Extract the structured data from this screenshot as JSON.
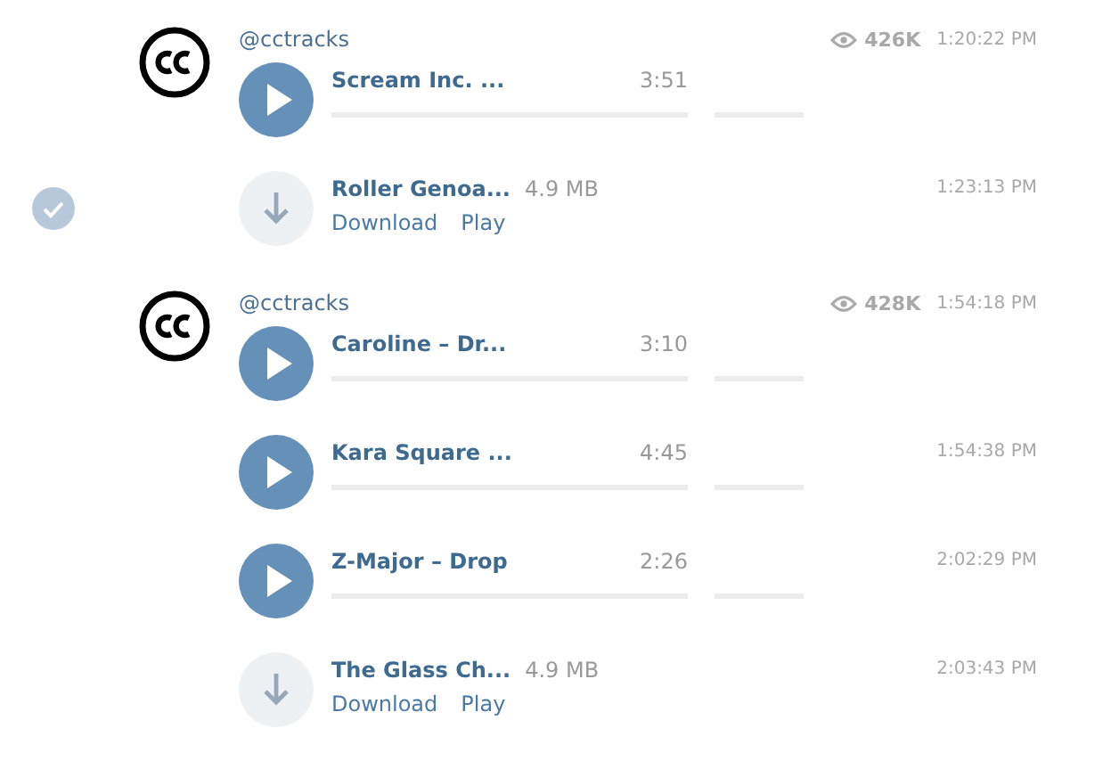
{
  "groups": [
    {
      "author": "@cctracks",
      "views": "426K",
      "time": "1:20:22 PM",
      "items": [
        {
          "kind": "audio",
          "title": "Scream Inc. ...",
          "duration": "3:51",
          "selected": false
        },
        {
          "kind": "file",
          "title": "Roller Genoa...",
          "size": "4.9 MB",
          "time": "1:23:13 PM",
          "actions": [
            "Download",
            "Play"
          ],
          "selected": true
        }
      ]
    },
    {
      "author": "@cctracks",
      "views": "428K",
      "time": "1:54:18 PM",
      "items": [
        {
          "kind": "audio",
          "title": "Caroline – Dr...",
          "duration": "3:10",
          "selected": false
        },
        {
          "kind": "audio",
          "title": "Kara Square ...",
          "duration": "4:45",
          "time": "1:54:38 PM",
          "selected": false
        },
        {
          "kind": "audio",
          "title": "Z-Major – Drop",
          "duration": "2:26",
          "time": "2:02:29 PM",
          "selected": false
        },
        {
          "kind": "file",
          "title": "The Glass Ch...",
          "size": "4.9 MB",
          "time": "2:03:43 PM",
          "actions": [
            "Download",
            "Play"
          ],
          "selected": false
        }
      ]
    }
  ]
}
